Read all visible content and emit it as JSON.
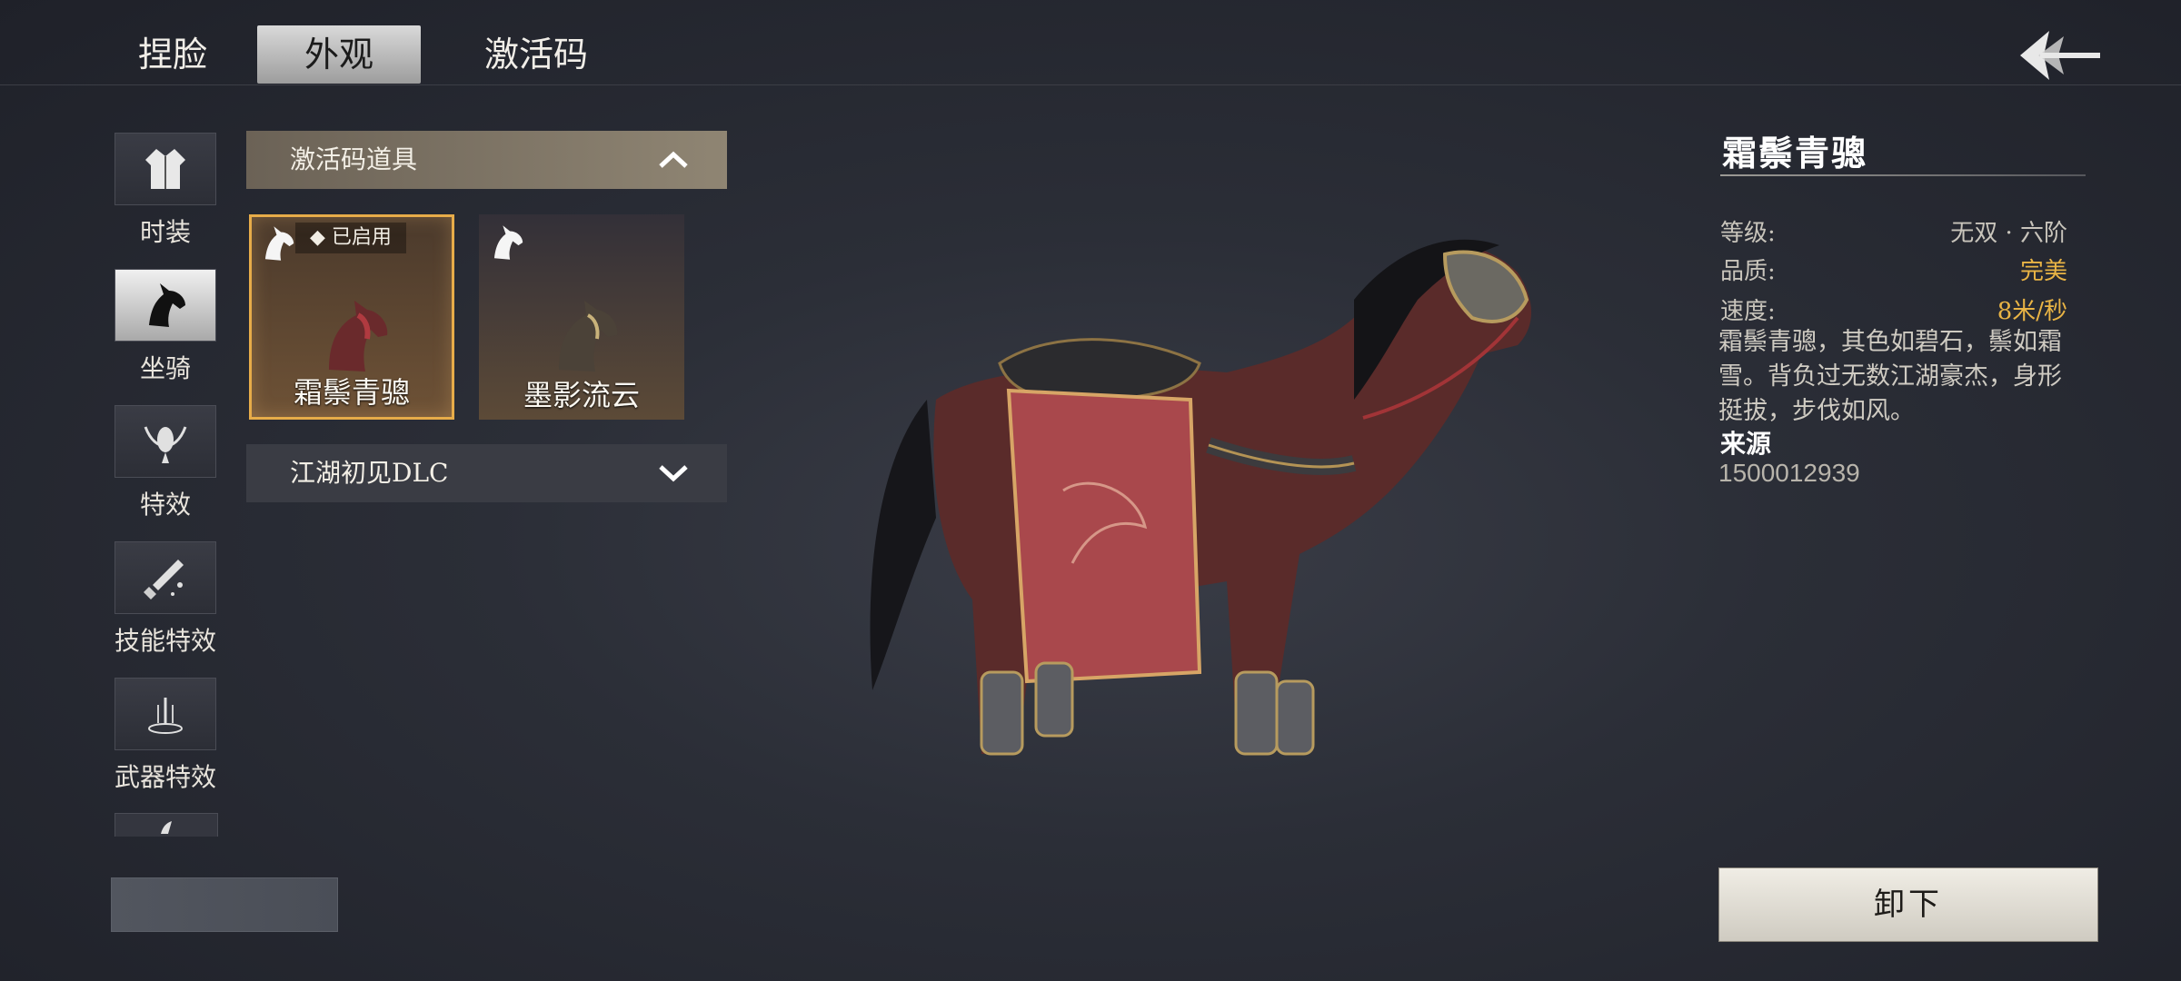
{
  "tabs": [
    "捏脸",
    "外观",
    "激活码"
  ],
  "active_tab": "外观",
  "categories": [
    {
      "label": "时装",
      "icon": "robe-icon"
    },
    {
      "label": "坐骑",
      "icon": "horse-head-icon"
    },
    {
      "label": "特效",
      "icon": "sprite-icon"
    },
    {
      "label": "技能特效",
      "icon": "sword-spark-icon"
    },
    {
      "label": "武器特效",
      "icon": "weapon-aura-icon"
    }
  ],
  "active_category": "坐骑",
  "sections": {
    "activation": "激活码道具",
    "dlc": "江湖初见DLC"
  },
  "cards": [
    {
      "name": "霜鬃青骢",
      "badge": "◆ 已启用",
      "selected": true
    },
    {
      "name": "墨影流云",
      "selected": false
    }
  ],
  "info": {
    "title": "霜鬃青骢",
    "rows": [
      {
        "key": "等级:",
        "value": "无双 · 六阶"
      },
      {
        "key": "品质:",
        "value": "完美"
      },
      {
        "key": "速度:",
        "value": "8米/秒"
      }
    ],
    "description": "霜鬃青骢，其色如碧石，鬃如霜雪。背负过无数江湖豪杰，身形挺拔，步伐如风。",
    "source_label": "来源",
    "source_value": "1500012939"
  },
  "unequip_label": "卸下",
  "colors": {
    "accent_gold": "#e9b445",
    "selected_border": "#e7ac49"
  }
}
